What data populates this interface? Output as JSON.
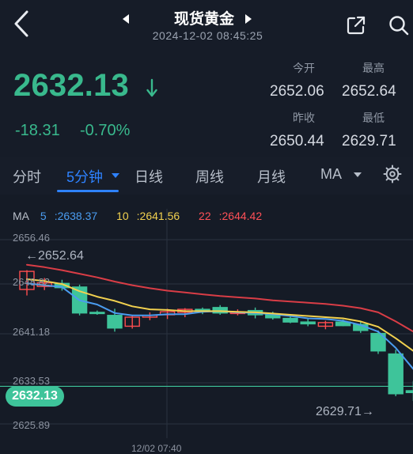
{
  "header": {
    "title": "现货黄金",
    "datetime": "2024-12-02 08:45:25"
  },
  "quote": {
    "last_price": "2632.13",
    "change": "-18.31",
    "change_pct": "-0.70%",
    "stats": [
      {
        "label": "今开",
        "value": "2652.06"
      },
      {
        "label": "最高",
        "value": "2652.64"
      },
      {
        "label": "昨收",
        "value": "2650.44"
      },
      {
        "label": "最低",
        "value": "2629.71"
      }
    ]
  },
  "tabs": [
    {
      "label": "分时"
    },
    {
      "label": "5分钟"
    },
    {
      "label": "日线"
    },
    {
      "label": "周线"
    },
    {
      "label": "月线"
    },
    {
      "label": "MA"
    }
  ],
  "colors": {
    "background": "#151b26",
    "up": "#ff4d4f",
    "down": "#3ec49a",
    "accent": "#2e82ff",
    "ma5": "#4a9cf0",
    "ma10": "#f2d14f",
    "ma22": "#d93d46"
  },
  "chart_data": {
    "type": "line",
    "title": "",
    "xlabel": "",
    "ylabel": "",
    "ylim": [
      2625.89,
      2656.46
    ],
    "y_ticks": [
      "2656.46",
      "2648.82",
      "2641.18",
      "2633.53",
      "2625.89"
    ],
    "x_ticks": [
      "12/02 07:40"
    ],
    "annotations": {
      "high": "2652.64",
      "low": "2629.71",
      "current": "2632.13"
    },
    "legend": [
      {
        "name": "MA",
        "value": ""
      },
      {
        "name": "5",
        "value": "2638.37"
      },
      {
        "name": "10",
        "value": "2641.56"
      },
      {
        "name": "22",
        "value": "2644.42"
      }
    ],
    "candles": [
      {
        "o": 2648.2,
        "h": 2651.4,
        "l": 2647.2,
        "c": 2651.2
      },
      {
        "o": 2648.7,
        "h": 2650.1,
        "l": 2648.1,
        "c": 2649.3
      },
      {
        "o": 2649.2,
        "h": 2649.8,
        "l": 2648.0,
        "c": 2648.5
      },
      {
        "o": 2648.6,
        "h": 2649.0,
        "l": 2643.9,
        "c": 2644.3
      },
      {
        "o": 2644.4,
        "h": 2644.7,
        "l": 2644.0,
        "c": 2644.2
      },
      {
        "o": 2643.9,
        "h": 2645.0,
        "l": 2641.2,
        "c": 2641.8
      },
      {
        "o": 2642.1,
        "h": 2643.9,
        "l": 2641.7,
        "c": 2643.6
      },
      {
        "o": 2643.6,
        "h": 2644.4,
        "l": 2643.1,
        "c": 2643.9
      },
      {
        "o": 2644.0,
        "h": 2645.0,
        "l": 2643.3,
        "c": 2644.5
      },
      {
        "o": 2644.4,
        "h": 2645.1,
        "l": 2643.6,
        "c": 2644.9
      },
      {
        "o": 2644.9,
        "h": 2645.2,
        "l": 2644.1,
        "c": 2644.6
      },
      {
        "o": 2645.2,
        "h": 2645.6,
        "l": 2644.0,
        "c": 2644.3
      },
      {
        "o": 2644.3,
        "h": 2644.9,
        "l": 2643.9,
        "c": 2644.4
      },
      {
        "o": 2644.7,
        "h": 2645.2,
        "l": 2643.4,
        "c": 2644.0
      },
      {
        "o": 2644.0,
        "h": 2644.5,
        "l": 2643.2,
        "c": 2643.5
      },
      {
        "o": 2643.4,
        "h": 2643.8,
        "l": 2642.6,
        "c": 2642.8
      },
      {
        "o": 2642.8,
        "h": 2643.4,
        "l": 2642.1,
        "c": 2642.5
      },
      {
        "o": 2642.1,
        "h": 2643.0,
        "l": 2641.6,
        "c": 2642.7
      },
      {
        "o": 2642.8,
        "h": 2643.2,
        "l": 2642.1,
        "c": 2642.2
      },
      {
        "o": 2642.4,
        "h": 2643.0,
        "l": 2641.0,
        "c": 2641.4
      },
      {
        "o": 2640.9,
        "h": 2641.4,
        "l": 2637.5,
        "c": 2638.0
      },
      {
        "o": 2637.5,
        "h": 2638.2,
        "l": 2630.5,
        "c": 2630.9
      },
      {
        "o": 2631.4,
        "h": 2633.0,
        "l": 2629.71,
        "c": 2631.1
      }
    ],
    "series": [
      {
        "name": "5",
        "values": [
          2649.2,
          2648.9,
          2648.6,
          2646.4,
          2645.7,
          2644.3,
          2643.9,
          2643.9,
          2644.1,
          2644.1,
          2644.5,
          2644.6,
          2644.4,
          2644.3,
          2644.1,
          2643.8,
          2643.4,
          2643.3,
          2643.0,
          2642.3,
          2641.2,
          2638.5,
          2635.0
        ]
      },
      {
        "name": "10",
        "values": [
          2649.9,
          2649.6,
          2649.1,
          2647.9,
          2647.0,
          2646.3,
          2645.4,
          2644.9,
          2644.8,
          2644.6,
          2644.6,
          2644.6,
          2644.5,
          2644.4,
          2644.2,
          2644.0,
          2643.8,
          2643.6,
          2643.4,
          2642.9,
          2642.0,
          2640.1,
          2638.0
        ]
      },
      {
        "name": "22",
        "values": [
          2652.3,
          2651.9,
          2651.4,
          2650.8,
          2650.2,
          2649.5,
          2648.9,
          2648.4,
          2648.0,
          2647.7,
          2647.4,
          2647.1,
          2646.9,
          2646.7,
          2646.4,
          2646.2,
          2646.0,
          2645.8,
          2645.5,
          2645.1,
          2644.4,
          2642.9,
          2641.2
        ]
      }
    ]
  }
}
